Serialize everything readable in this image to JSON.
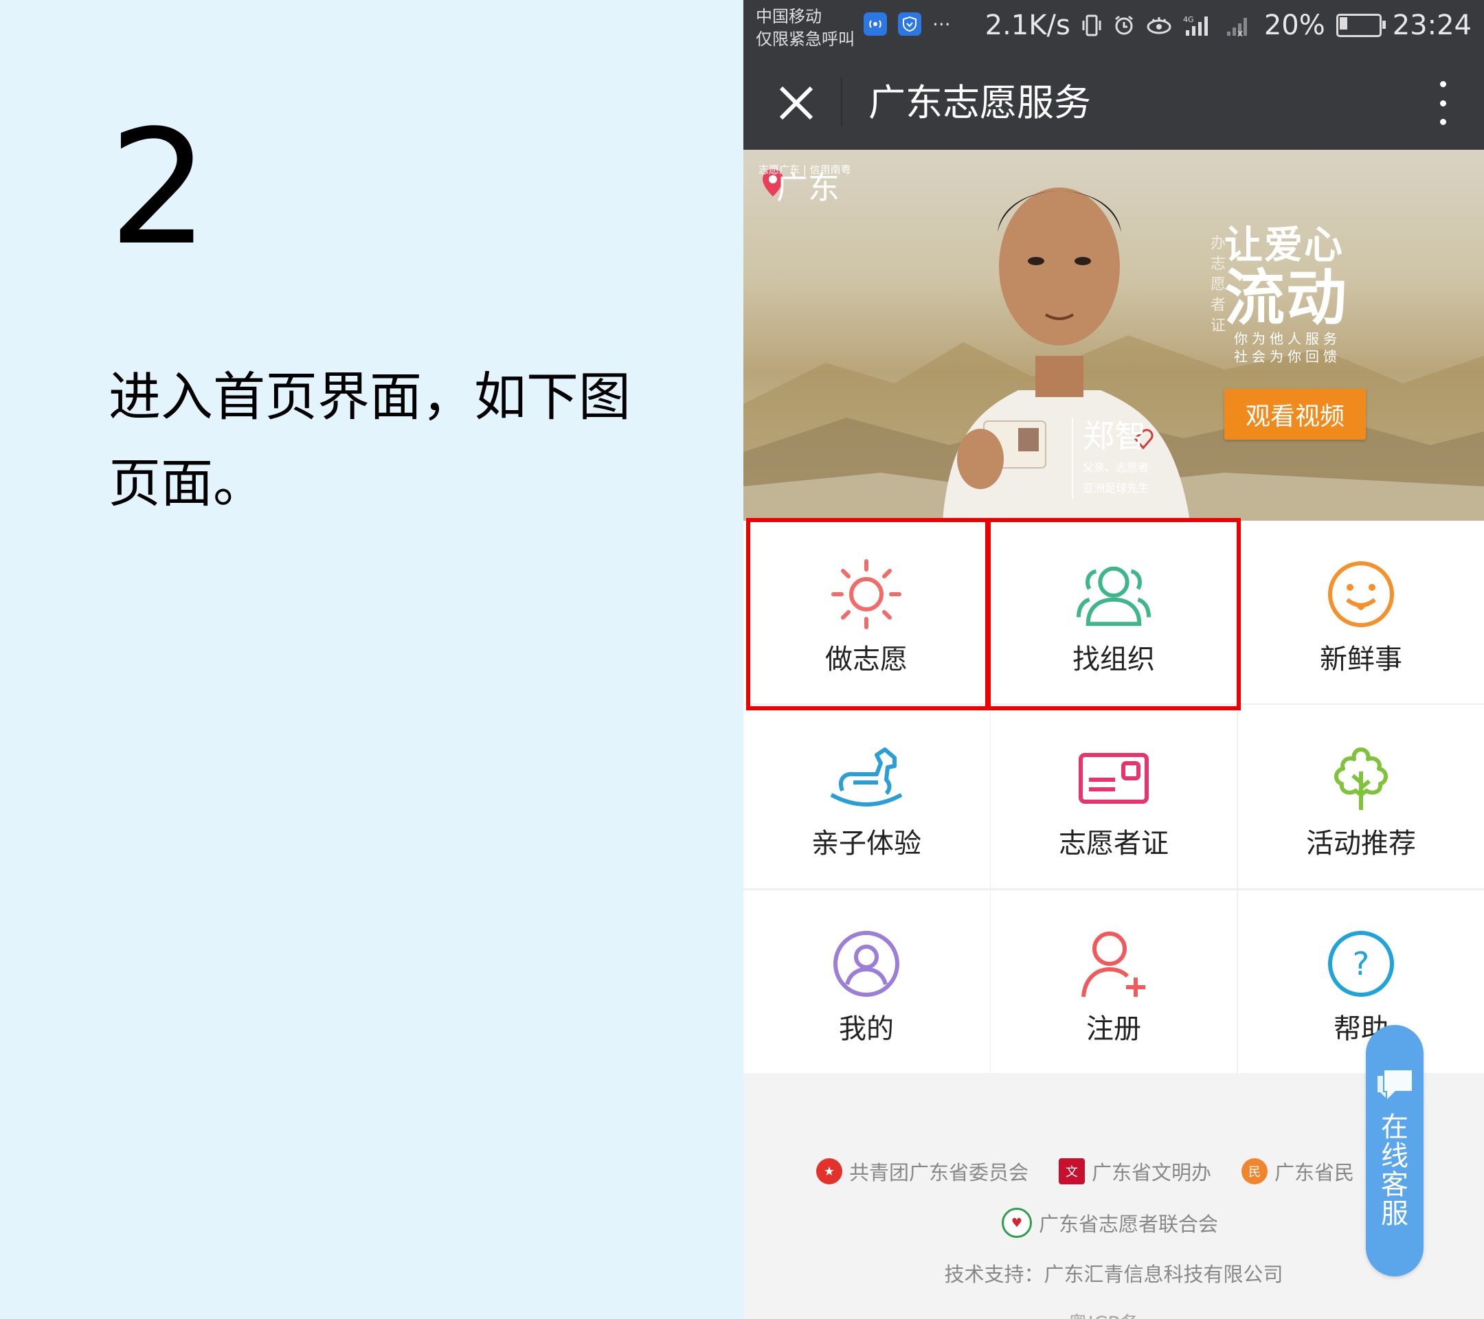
{
  "tutorial": {
    "step_number": "2",
    "instruction": "进入首页界面，如下图页面。"
  },
  "status_bar": {
    "carrier": "中国移动",
    "carrier_sub": "仅限紧急呼叫",
    "more": "···",
    "net_speed": "2.1K/s",
    "battery": "20%",
    "time": "23:24"
  },
  "titlebar": {
    "title": "广东志愿服务"
  },
  "banner": {
    "location_small": "志愿广东 | 信用南粤",
    "location": "广东",
    "vertical_text": "办志愿者证",
    "slogan_line1": "让爱心",
    "slogan_line2": "流动",
    "slogan_line3": "你为他人服务",
    "slogan_line4": "社会为你回馈",
    "name": "郑智",
    "name_desc1": "父亲、志愿者",
    "name_desc2": "亚洲足球先生",
    "watch_button": "观看视频"
  },
  "menu": [
    {
      "label": "做志愿",
      "icon": "sun-icon",
      "color": "#f26b6b"
    },
    {
      "label": "找组织",
      "icon": "group-icon",
      "color": "#3db68a"
    },
    {
      "label": "新鲜事",
      "icon": "smile-icon",
      "color": "#f5902a"
    },
    {
      "label": "亲子体验",
      "icon": "rocking-horse-icon",
      "color": "#2a9ed6"
    },
    {
      "label": "志愿者证",
      "icon": "id-card-icon",
      "color": "#e8336d"
    },
    {
      "label": "活动推荐",
      "icon": "tree-icon",
      "color": "#7fc33a"
    },
    {
      "label": "我的",
      "icon": "user-circle-icon",
      "color": "#9b7ed8"
    },
    {
      "label": "注册",
      "icon": "add-user-icon",
      "color": "#f05a5a"
    },
    {
      "label": "帮助",
      "icon": "help-icon",
      "color": "#1ea3db"
    }
  ],
  "footer": {
    "sponsors": [
      "共青团广东省委员会",
      "广东省文明办",
      "广东省民"
    ],
    "sponsor2": "广东省志愿者联合会",
    "tech_support": "技术支持：广东汇青信息科技有限公司",
    "icp": "粤ICP备…"
  },
  "service_button": {
    "label": "在线客服"
  }
}
